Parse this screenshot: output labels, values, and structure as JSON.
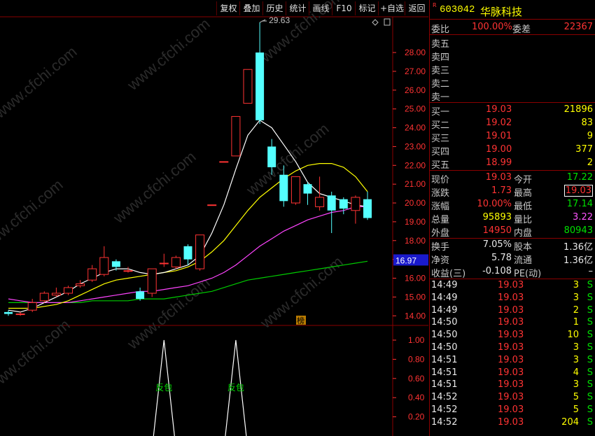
{
  "toolbar": {
    "buttons": [
      "复权",
      "叠加",
      "历史",
      "统计",
      "画线",
      "F10",
      "标记",
      "+自选",
      "返回"
    ]
  },
  "chart": {
    "price_ticks": [
      "28.00",
      "27.00",
      "26.00",
      "25.00",
      "24.00",
      "23.00",
      "22.00",
      "21.00",
      "20.00",
      "19.00",
      "18.00",
      "17.00",
      "16.00",
      "15.00",
      "14.00"
    ],
    "price_tick_values": [
      28,
      27,
      26,
      25,
      24,
      23,
      22,
      21,
      20,
      19,
      18,
      17,
      16,
      15,
      14
    ],
    "max_label": "29.63",
    "current_price_badge": "16.97",
    "rank_marker": "榜",
    "indicator_ticks": [
      "1.00",
      "0.80",
      "0.60",
      "0.40",
      "0.20"
    ],
    "indicator_ticks_values": [
      1.0,
      0.8,
      0.6,
      0.4,
      0.2
    ],
    "signal_label": "反包",
    "watermark": "www.cfchi.com",
    "colors": {
      "up": "#ff3333",
      "down": "#54ffff",
      "ma5": "#ffffff",
      "ma10": "#ffff00",
      "ma20": "#ff44ff",
      "ma60": "#00cc00",
      "axis": "#ff3333"
    }
  },
  "chart_data": {
    "type": "candlestick",
    "candles": [
      {
        "o": 14.2,
        "c": 14.1,
        "h": 14.3,
        "l": 14.0
      },
      {
        "o": 14.1,
        "c": 14.1,
        "h": 14.2,
        "l": 14.0
      },
      {
        "o": 14.3,
        "c": 14.7,
        "h": 14.9,
        "l": 14.2
      },
      {
        "o": 14.8,
        "c": 15.2,
        "h": 15.3,
        "l": 14.7
      },
      {
        "o": 15.1,
        "c": 15.2,
        "h": 15.5,
        "l": 15.0
      },
      {
        "o": 15.2,
        "c": 15.5,
        "h": 15.6,
        "l": 15.1
      },
      {
        "o": 15.6,
        "c": 15.7,
        "h": 15.9,
        "l": 15.5
      },
      {
        "o": 15.9,
        "c": 16.5,
        "h": 16.7,
        "l": 15.8
      },
      {
        "o": 16.2,
        "c": 17.1,
        "h": 17.7,
        "l": 16.1
      },
      {
        "o": 16.9,
        "c": 16.6,
        "h": 17.0,
        "l": 16.4
      },
      {
        "o": 16.4,
        "c": 16.4,
        "h": 16.6,
        "l": 16.3
      },
      {
        "o": 15.3,
        "c": 14.9,
        "h": 15.5,
        "l": 14.8
      },
      {
        "o": 15.2,
        "c": 16.5,
        "h": 16.5,
        "l": 15.0
      },
      {
        "o": 16.8,
        "c": 16.8,
        "h": 17.3,
        "l": 16.6
      },
      {
        "o": 16.6,
        "c": 17.1,
        "h": 17.2,
        "l": 16.5
      },
      {
        "o": 17.7,
        "c": 17.0,
        "h": 17.8,
        "l": 16.7
      },
      {
        "o": 16.5,
        "c": 18.3,
        "h": 18.3,
        "l": 16.4
      },
      {
        "o": 19.9,
        "c": 19.9,
        "h": 19.9,
        "l": 19.9
      },
      {
        "o": 22.2,
        "c": 22.2,
        "h": 22.2,
        "l": 22.2
      },
      {
        "o": 22.5,
        "c": 24.6,
        "h": 24.6,
        "l": 22.5
      },
      {
        "o": 25.3,
        "c": 27.1,
        "h": 27.1,
        "l": 25.3
      },
      {
        "o": 28.0,
        "c": 24.4,
        "h": 29.6,
        "l": 24.2
      },
      {
        "o": 23.0,
        "c": 21.9,
        "h": 23.4,
        "l": 21.5
      },
      {
        "o": 21.5,
        "c": 20.1,
        "h": 22.0,
        "l": 19.8
      },
      {
        "o": 20.0,
        "c": 21.4,
        "h": 21.4,
        "l": 19.9
      },
      {
        "o": 21.0,
        "c": 20.5,
        "h": 21.1,
        "l": 19.9
      },
      {
        "o": 19.8,
        "c": 20.3,
        "h": 21.4,
        "l": 19.6
      },
      {
        "o": 20.4,
        "c": 19.6,
        "h": 20.6,
        "l": 18.4
      },
      {
        "o": 20.2,
        "c": 19.7,
        "h": 20.3,
        "l": 19.4
      },
      {
        "o": 19.6,
        "c": 20.3,
        "h": 20.4,
        "l": 18.9
      },
      {
        "o": 20.2,
        "c": 19.2,
        "h": 20.6,
        "l": 19.1
      }
    ],
    "ma5": [
      14.3,
      14.2,
      14.4,
      14.7,
      15.0,
      15.3,
      15.7,
      16.0,
      16.3,
      16.5,
      16.5,
      16.3,
      16.2,
      16.3,
      16.5,
      16.7,
      17.2,
      18.4,
      19.9,
      21.8,
      23.6,
      24.4,
      24.0,
      23.1,
      22.2,
      21.1,
      20.5,
      20.3,
      20.1,
      19.9,
      19.8
    ],
    "ma10": [
      14.4,
      14.4,
      14.4,
      14.5,
      14.6,
      14.8,
      15.1,
      15.4,
      15.7,
      15.9,
      16.0,
      16.1,
      16.2,
      16.3,
      16.4,
      16.6,
      16.9,
      17.4,
      18.0,
      18.8,
      19.6,
      20.3,
      20.8,
      21.3,
      21.7,
      22.0,
      22.1,
      22.1,
      21.9,
      21.4,
      20.6
    ],
    "ma20": [
      14.9,
      14.8,
      14.7,
      14.7,
      14.7,
      14.7,
      14.8,
      14.9,
      15.0,
      15.1,
      15.2,
      15.3,
      15.3,
      15.4,
      15.5,
      15.6,
      15.8,
      16.0,
      16.3,
      16.7,
      17.2,
      17.7,
      18.1,
      18.5,
      18.8,
      19.1,
      19.3,
      19.5,
      19.6,
      19.8,
      19.8
    ],
    "ma60": [
      14.7,
      14.7,
      14.7,
      14.7,
      14.7,
      14.7,
      14.7,
      14.8,
      14.8,
      14.8,
      14.8,
      14.9,
      14.9,
      14.9,
      15.0,
      15.1,
      15.2,
      15.3,
      15.5,
      15.7,
      15.9,
      16.0,
      16.1,
      16.2,
      16.3,
      16.4,
      16.5,
      16.6,
      16.7,
      16.8,
      16.9
    ],
    "indicator": [
      0,
      0,
      0,
      0,
      0,
      0,
      0,
      0,
      0,
      0,
      0,
      0,
      0,
      1,
      0,
      0,
      0,
      0,
      0,
      1,
      0,
      0,
      0,
      0,
      0,
      0,
      0,
      0,
      0,
      0,
      0
    ],
    "ylim": [
      13.6,
      29.9
    ]
  },
  "quote": {
    "code": "603042",
    "name": "华脉科技",
    "wei_bi_label": "委比",
    "wei_bi": "100.00%",
    "wei_cha_label": "委差",
    "wei_cha": "22367",
    "sells": [
      "卖五",
      "卖四",
      "卖三",
      "卖二",
      "卖一"
    ],
    "buys": [
      {
        "label": "买一",
        "price": "19.03",
        "vol": "21896"
      },
      {
        "label": "买二",
        "price": "19.02",
        "vol": "83"
      },
      {
        "label": "买三",
        "price": "19.01",
        "vol": "9"
      },
      {
        "label": "买四",
        "price": "19.00",
        "vol": "377"
      },
      {
        "label": "买五",
        "price": "18.99",
        "vol": "2"
      }
    ],
    "stats": [
      {
        "l1": "现价",
        "v1": "19.03",
        "c1": "red",
        "l2": "今开",
        "v2": "17.22",
        "c2": "grn"
      },
      {
        "l1": "涨跌",
        "v1": "1.73",
        "c1": "red",
        "l2": "最高",
        "v2": "19.03",
        "c2": "red"
      },
      {
        "l1": "涨幅",
        "v1": "10.00%",
        "c1": "red",
        "l2": "最低",
        "v2": "17.14",
        "c2": "grn"
      },
      {
        "l1": "总量",
        "v1": "95893",
        "c1": "yel",
        "l2": "量比",
        "v2": "3.22",
        "c2": "mag"
      },
      {
        "l1": "外盘",
        "v1": "14950",
        "c1": "red",
        "l2": "内盘",
        "v2": "80943",
        "c2": "grn"
      }
    ],
    "stats2": [
      {
        "l1": "换手",
        "v1": "7.05%",
        "l2": "股本",
        "v2": "1.36亿"
      },
      {
        "l1": "净资",
        "v1": "5.78",
        "l2": "流通",
        "v2": "1.36亿"
      },
      {
        "l1": "收益(三)",
        "v1": "-0.108",
        "l2": "PE(动)",
        "v2": "–"
      }
    ],
    "ticks": [
      {
        "t": "14:49",
        "p": "19.03",
        "v": "3",
        "s": "S"
      },
      {
        "t": "14:49",
        "p": "19.03",
        "v": "3",
        "s": "S"
      },
      {
        "t": "14:49",
        "p": "19.03",
        "v": "2",
        "s": "S"
      },
      {
        "t": "14:50",
        "p": "19.03",
        "v": "1",
        "s": "S"
      },
      {
        "t": "14:50",
        "p": "19.03",
        "v": "10",
        "s": "S"
      },
      {
        "t": "14:50",
        "p": "19.03",
        "v": "3",
        "s": "S"
      },
      {
        "t": "14:51",
        "p": "19.03",
        "v": "3",
        "s": "S"
      },
      {
        "t": "14:51",
        "p": "19.03",
        "v": "4",
        "s": "S"
      },
      {
        "t": "14:51",
        "p": "19.03",
        "v": "3",
        "s": "S"
      },
      {
        "t": "14:52",
        "p": "19.03",
        "v": "5",
        "s": "S"
      },
      {
        "t": "14:52",
        "p": "19.03",
        "v": "5",
        "s": "S"
      },
      {
        "t": "14:52",
        "p": "19.03",
        "v": "204",
        "s": "S"
      }
    ]
  }
}
